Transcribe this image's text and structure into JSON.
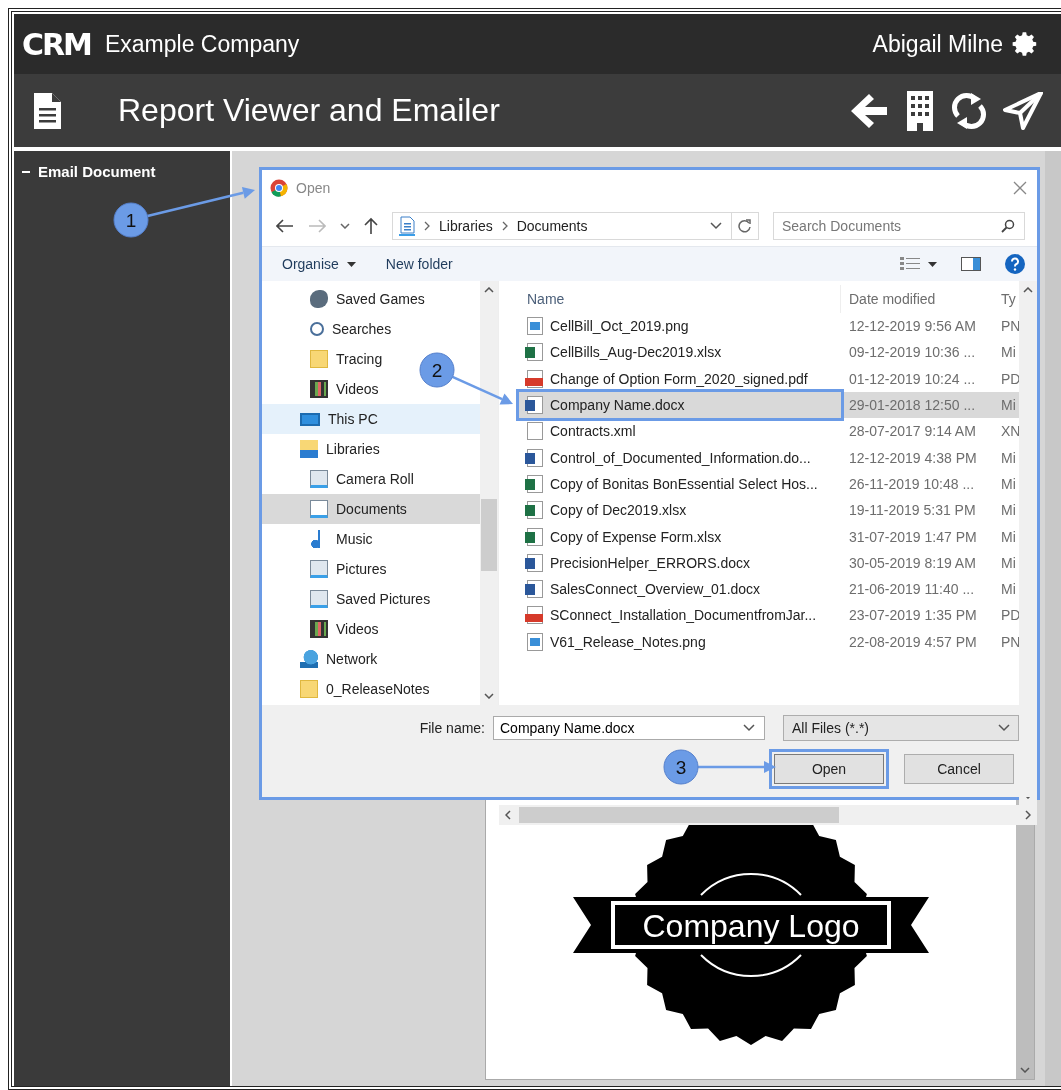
{
  "app": {
    "logo": "CRM",
    "company": "Example Company",
    "user": "Abigail Milne"
  },
  "page_header": {
    "title": "Report Viewer and Emailer"
  },
  "sidebar": {
    "items": [
      {
        "label": "Email Document",
        "expanded": true
      }
    ]
  },
  "document": {
    "logo_text": "Company Logo"
  },
  "dialog": {
    "title": "Open",
    "annotated": true,
    "address": {
      "breadcrumbs": [
        "Libraries",
        "Documents"
      ]
    },
    "search": {
      "placeholder": "Search Documents"
    },
    "toolbar": {
      "organise": "Organise",
      "new_folder": "New folder"
    },
    "nav_pane": {
      "items_above": [
        {
          "label": "Saved Games",
          "kind": "games",
          "selected": false,
          "hovered": false
        },
        {
          "label": "Searches",
          "kind": "search",
          "selected": false,
          "hovered": false
        },
        {
          "label": "Tracing",
          "kind": "folder",
          "selected": false,
          "hovered": false
        },
        {
          "label": "Videos",
          "kind": "videos",
          "selected": false,
          "hovered": false
        }
      ],
      "items": [
        {
          "label": "This PC",
          "kind": "pc",
          "selected": false,
          "hovered": true
        },
        {
          "label": "Libraries",
          "kind": "library",
          "selected": false,
          "hovered": false,
          "children": [
            {
              "label": "Camera Roll",
              "kind": "images",
              "selected": false,
              "hovered": false
            },
            {
              "label": "Documents",
              "kind": "documents",
              "selected": true,
              "hovered": false
            },
            {
              "label": "Music",
              "kind": "music",
              "selected": false,
              "hovered": false
            },
            {
              "label": "Pictures",
              "kind": "images",
              "selected": false,
              "hovered": false
            },
            {
              "label": "Saved Pictures",
              "kind": "images",
              "selected": false,
              "hovered": false
            },
            {
              "label": "Videos",
              "kind": "videos",
              "selected": false,
              "hovered": false
            }
          ]
        },
        {
          "label": "Network",
          "kind": "network",
          "selected": false,
          "hovered": false
        },
        {
          "label": "0_ReleaseNotes",
          "kind": "folder",
          "selected": false,
          "hovered": false
        }
      ]
    },
    "files": {
      "columns": [
        "Name",
        "Date modified",
        "Ty"
      ],
      "rows": [
        {
          "name": "CellBill_Oct_2019.png",
          "date": "12-12-2019 9:56 AM",
          "type": "PN",
          "kind": "png",
          "selected": false,
          "annotated": false
        },
        {
          "name": "CellBills_Aug-Dec2019.xlsx",
          "date": "09-12-2019 10:36 ...",
          "type": "Mi",
          "kind": "xlsx",
          "selected": false,
          "annotated": false
        },
        {
          "name": "Change of Option Form_2020_signed.pdf",
          "date": "01-12-2019 10:24 ...",
          "type": "PD",
          "kind": "pdf",
          "selected": false,
          "annotated": false
        },
        {
          "name": "Company Name.docx",
          "date": "29-01-2018 12:50 ...",
          "type": "Mi",
          "kind": "docx",
          "selected": true,
          "annotated": true
        },
        {
          "name": "Contracts.xml",
          "date": "28-07-2017 9:14 AM",
          "type": "XN",
          "kind": "xml",
          "selected": false,
          "annotated": false
        },
        {
          "name": "Control_of_Documented_Information.do...",
          "date": "12-12-2019 4:38 PM",
          "type": "Mi",
          "kind": "docx",
          "selected": false,
          "annotated": false
        },
        {
          "name": "Copy of Bonitas BonEssential Select Hos...",
          "date": "26-11-2019 10:48 ...",
          "type": "Mi",
          "kind": "xlsx",
          "selected": false,
          "annotated": false
        },
        {
          "name": "Copy of Dec2019.xlsx",
          "date": "19-11-2019 5:31 PM",
          "type": "Mi",
          "kind": "xlsx",
          "selected": false,
          "annotated": false
        },
        {
          "name": "Copy of Expense Form.xlsx",
          "date": "31-07-2019 1:47 PM",
          "type": "Mi",
          "kind": "xlsx",
          "selected": false,
          "annotated": false
        },
        {
          "name": "PrecisionHelper_ERRORS.docx",
          "date": "30-05-2019 8:19 AM",
          "type": "Mi",
          "kind": "docx",
          "selected": false,
          "annotated": false
        },
        {
          "name": "SalesConnect_Overview_01.docx",
          "date": "21-06-2019 11:40 ...",
          "type": "Mi",
          "kind": "docx",
          "selected": false,
          "annotated": false
        },
        {
          "name": "SConnect_Installation_DocumentfromJar...",
          "date": "23-07-2019 1:35 PM",
          "type": "PD",
          "kind": "pdf",
          "selected": false,
          "annotated": false
        },
        {
          "name": "V61_Release_Notes.png",
          "date": "22-08-2019 4:57 PM",
          "type": "PN",
          "kind": "png",
          "selected": false,
          "annotated": false
        }
      ]
    },
    "file_name": {
      "label": "File name:",
      "value": "Company Name.docx"
    },
    "filter": {
      "value": "All Files (*.*)"
    },
    "buttons": [
      {
        "label": "Open",
        "annotated": true
      },
      {
        "label": "Cancel",
        "annotated": false
      }
    ]
  },
  "callouts": [
    {
      "number": "1"
    },
    {
      "number": "2"
    },
    {
      "number": "3"
    }
  ]
}
